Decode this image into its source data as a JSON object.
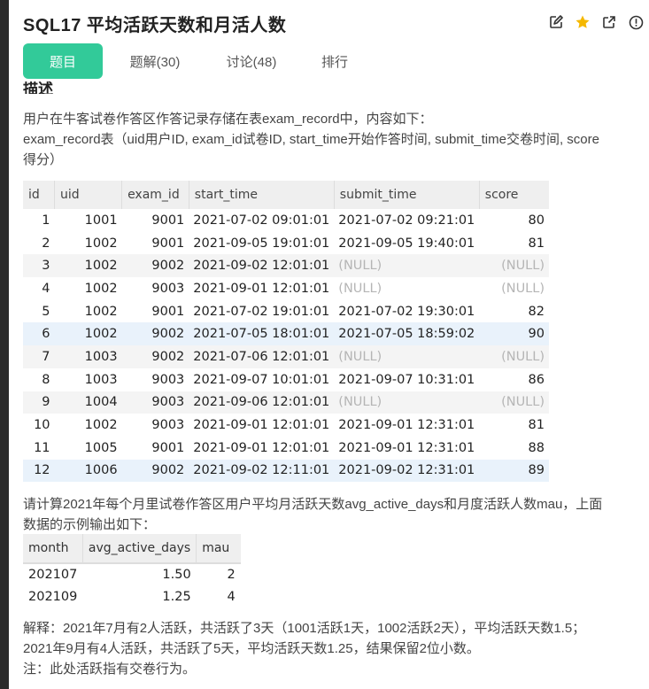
{
  "header": {
    "title": "SQL17  平均活跃天数和月活人数",
    "icons": [
      "edit-icon",
      "star-icon",
      "share-icon",
      "info-icon"
    ],
    "star_color": "#f5b800"
  },
  "tabs": [
    {
      "label": "题目",
      "active": true
    },
    {
      "label": "题解(30)",
      "active": false
    },
    {
      "label": "讨论(48)",
      "active": false
    },
    {
      "label": "排行",
      "active": false
    }
  ],
  "accent_color": "#32ca99",
  "section_heading": "描述",
  "intro": {
    "line1": "用户在牛客试卷作答区作答记录存储在表exam_record中，内容如下：",
    "line2": "exam_record表（uid用户ID, exam_id试卷ID, start_time开始作答时间, submit_time交卷时间, score",
    "line3": "得分）"
  },
  "exam_record_table": {
    "columns": [
      "id",
      "uid",
      "exam_id",
      "start_time",
      "submit_time",
      "score"
    ],
    "rows": [
      [
        "1",
        "1001",
        "9001",
        "2021-07-02 09:01:01",
        "2021-07-02 09:21:01",
        "80"
      ],
      [
        "2",
        "1002",
        "9001",
        "2021-09-05 19:01:01",
        "2021-09-05 19:40:01",
        "81"
      ],
      [
        "3",
        "1002",
        "9002",
        "2021-09-02 12:01:01",
        "(NULL)",
        "(NULL)"
      ],
      [
        "4",
        "1002",
        "9003",
        "2021-09-01 12:01:01",
        "(NULL)",
        "(NULL)"
      ],
      [
        "5",
        "1002",
        "9001",
        "2021-07-02 19:01:01",
        "2021-07-02 19:30:01",
        "82"
      ],
      [
        "6",
        "1002",
        "9002",
        "2021-07-05 18:01:01",
        "2021-07-05 18:59:02",
        "90"
      ],
      [
        "7",
        "1003",
        "9002",
        "2021-07-06 12:01:01",
        "(NULL)",
        "(NULL)"
      ],
      [
        "8",
        "1003",
        "9003",
        "2021-09-07 10:01:01",
        "2021-09-07 10:31:01",
        "86"
      ],
      [
        "9",
        "1004",
        "9003",
        "2021-09-06 12:01:01",
        "(NULL)",
        "(NULL)"
      ],
      [
        "10",
        "1002",
        "9003",
        "2021-09-01 12:01:01",
        "2021-09-01 12:31:01",
        "81"
      ],
      [
        "11",
        "1005",
        "9001",
        "2021-09-01 12:01:01",
        "2021-09-01 12:31:01",
        "88"
      ],
      [
        "12",
        "1006",
        "9002",
        "2021-09-02 12:11:01",
        "2021-09-02 12:31:01",
        "89"
      ]
    ]
  },
  "task": {
    "line1": "请计算2021年每个月里试卷作答区用户平均月活跃天数avg_active_days和月度活跃人数mau，上面",
    "line2": "数据的示例输出如下："
  },
  "output_table": {
    "columns": [
      "month",
      "avg_active_days",
      "mau"
    ],
    "rows": [
      [
        "202107",
        "1.50",
        "2"
      ],
      [
        "202109",
        "1.25",
        "4"
      ]
    ]
  },
  "explanation": {
    "line1": "解释：2021年7月有2人活跃，共活跃了3天（1001活跃1天，1002活跃2天），平均活跃天数1.5；",
    "line2": "2021年9月有4人活跃，共活跃了5天，平均活跃天数1.25，结果保留2位小数。",
    "line3": "注：此处活跃指有交卷行为。"
  }
}
